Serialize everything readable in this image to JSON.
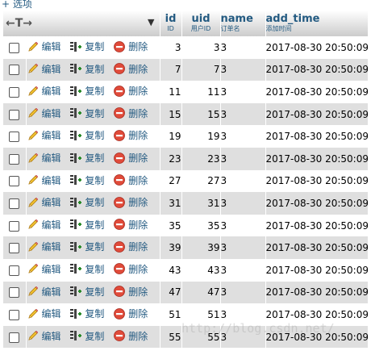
{
  "options_label": "+ 选项",
  "header": {
    "arrows": "←T→",
    "columns": [
      {
        "name": "id",
        "comment": "ID"
      },
      {
        "name": "uid",
        "comment": "用户ID"
      },
      {
        "name": "name",
        "comment": "订单名"
      },
      {
        "name": "add_time",
        "comment": "添加时间"
      }
    ]
  },
  "actions": {
    "edit": "编辑",
    "copy": "复制",
    "delete": "删除"
  },
  "rows": [
    {
      "id": "3",
      "uid": "3",
      "name": "3",
      "add_time": "2017-08-30 20:50:09"
    },
    {
      "id": "7",
      "uid": "7",
      "name": "3",
      "add_time": "2017-08-30 20:50:09"
    },
    {
      "id": "11",
      "uid": "11",
      "name": "3",
      "add_time": "2017-08-30 20:50:09"
    },
    {
      "id": "15",
      "uid": "15",
      "name": "3",
      "add_time": "2017-08-30 20:50:09"
    },
    {
      "id": "19",
      "uid": "19",
      "name": "3",
      "add_time": "2017-08-30 20:50:09"
    },
    {
      "id": "23",
      "uid": "23",
      "name": "3",
      "add_time": "2017-08-30 20:50:09"
    },
    {
      "id": "27",
      "uid": "27",
      "name": "3",
      "add_time": "2017-08-30 20:50:09"
    },
    {
      "id": "31",
      "uid": "31",
      "name": "3",
      "add_time": "2017-08-30 20:50:09"
    },
    {
      "id": "35",
      "uid": "35",
      "name": "3",
      "add_time": "2017-08-30 20:50:09"
    },
    {
      "id": "39",
      "uid": "39",
      "name": "3",
      "add_time": "2017-08-30 20:50:09"
    },
    {
      "id": "43",
      "uid": "43",
      "name": "3",
      "add_time": "2017-08-30 20:50:09"
    },
    {
      "id": "47",
      "uid": "47",
      "name": "3",
      "add_time": "2017-08-30 20:50:09"
    },
    {
      "id": "51",
      "uid": "51",
      "name": "3",
      "add_time": "2017-08-30 20:50:09"
    },
    {
      "id": "55",
      "uid": "55",
      "name": "3",
      "add_time": "2017-08-30 20:50:09"
    }
  ],
  "watermark": "http://blog.csdn.net/"
}
